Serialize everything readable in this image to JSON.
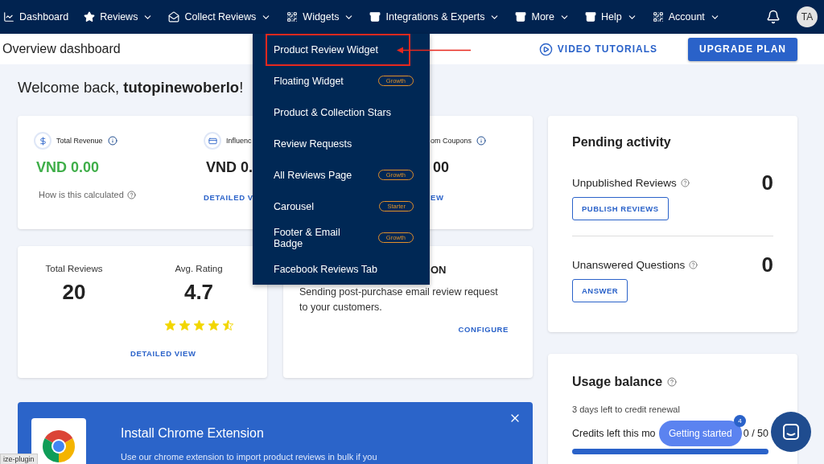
{
  "nav": {
    "items": [
      {
        "label": "Dashboard",
        "dropdown": false
      },
      {
        "label": "Reviews",
        "dropdown": true
      },
      {
        "label": "Collect Reviews",
        "dropdown": true
      },
      {
        "label": "Widgets",
        "dropdown": true
      },
      {
        "label": "Integrations & Experts",
        "dropdown": true
      },
      {
        "label": "More",
        "dropdown": true
      },
      {
        "label": "Help",
        "dropdown": true
      },
      {
        "label": "Account",
        "dropdown": true
      }
    ],
    "avatar": "TA"
  },
  "header": {
    "title": "Overview dashboard",
    "video_link": "VIDEO TUTORIALS",
    "upgrade_button": "UPGRADE PLAN"
  },
  "welcome": "Welcome back, **tutopinewoberlo**!",
  "stats": [
    {
      "label": "Total Revenue",
      "value": "VND 0.00",
      "link": "How is this calculated",
      "kind": "revenue"
    },
    {
      "label": "Influenc",
      "value": "VND 0.",
      "link": "DETAILED V",
      "kind": "partial"
    },
    {
      "label": "om Coupons",
      "value": "00",
      "link": "EW",
      "kind": "cut"
    }
  ],
  "reviews_card": {
    "total_label": "Total Reviews",
    "total": "20",
    "rating_label": "Avg. Rating",
    "rating": "4.7",
    "stars": 4.5,
    "link": "DETAILED VIEW"
  },
  "email_card": {
    "title": "ON",
    "text": "Sending post-purchase email review request to your customers.",
    "link": "CONFIGURE"
  },
  "banner": {
    "title": "Install Chrome Extension",
    "text": "Use our chrome extension to import product reviews in bulk if you"
  },
  "pending": {
    "title": "Pending activity",
    "rows": [
      {
        "label": "Unpublished Reviews",
        "count": "0",
        "button": "PUBLISH REVIEWS"
      },
      {
        "label": "Unanswered Questions",
        "count": "0",
        "button": "ANSWER"
      }
    ]
  },
  "usage": {
    "title": "Usage balance",
    "renewal": "3 days left to credit renewal",
    "credits_label": "Credits left this mo",
    "credits": "0 / 50",
    "level": 1
  },
  "widgets_menu": [
    {
      "label": "Product Review Widget",
      "highlighted": true
    },
    {
      "label": "Floating Widget",
      "badge": "Growth",
      "highlighted": false
    },
    {
      "label": "Product & Collection Stars",
      "highlighted": false
    },
    {
      "label": "Review Requests",
      "highlighted": false
    },
    {
      "label": "All Reviews Page",
      "badge": "Growth",
      "highlighted": false
    },
    {
      "label": "Carousel",
      "badge": "Starter",
      "highlighted": false
    },
    {
      "label": "Footer & Email Badge",
      "badge": "Growth",
      "highlighted": false
    },
    {
      "label": "Facebook Reviews Tab",
      "highlighted": false
    }
  ],
  "getting_started": {
    "label": "Getting started",
    "count": "4"
  },
  "tooltip": "ize-plugin"
}
